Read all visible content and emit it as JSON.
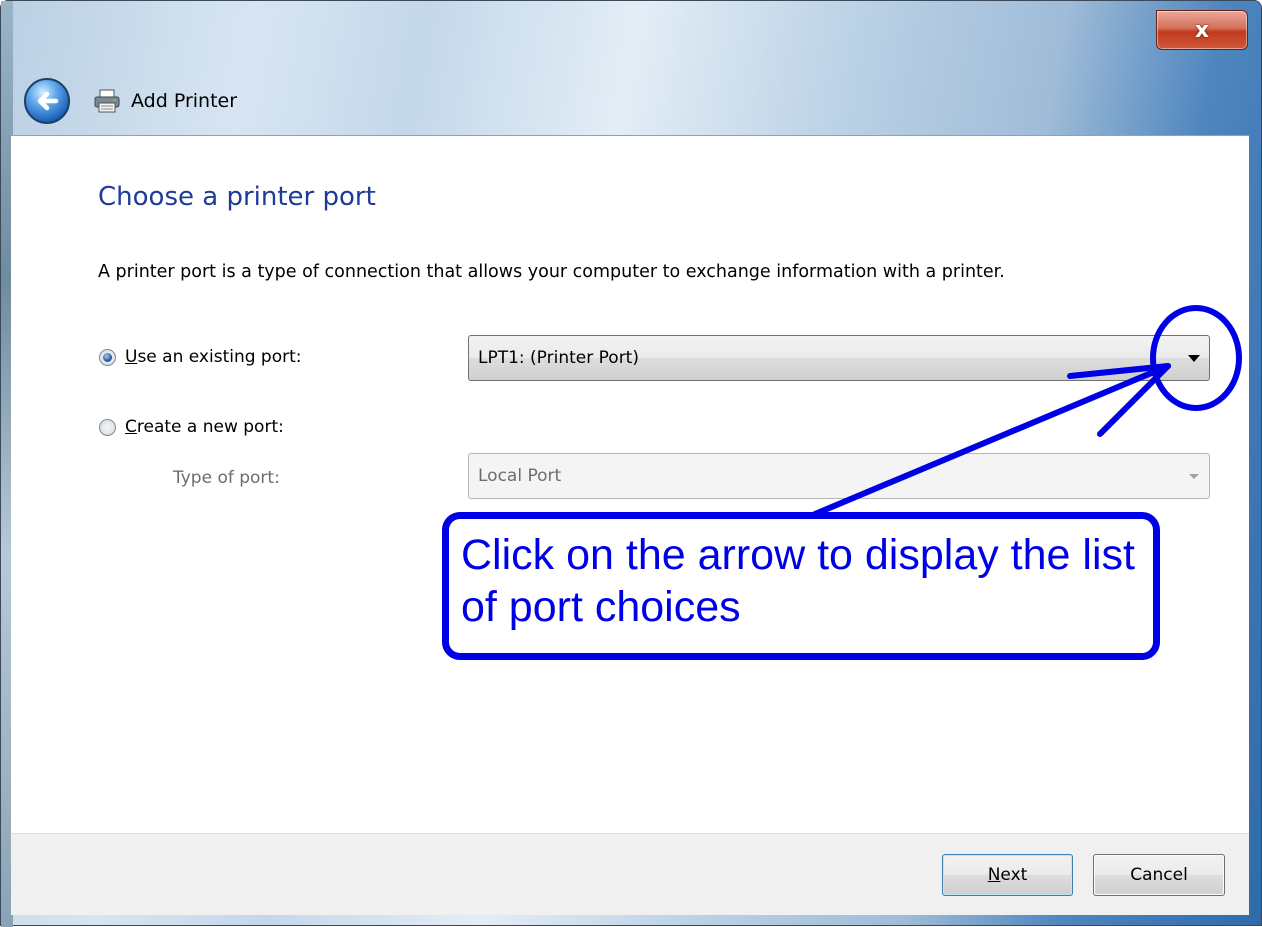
{
  "window": {
    "title": "Add Printer",
    "close_label": "x"
  },
  "page": {
    "heading": "Choose a printer port",
    "description": "A printer port is a type of connection that allows your computer to exchange information with a printer."
  },
  "options": {
    "existing": {
      "label_underlined": "U",
      "label_rest": "se an existing port:",
      "selected": true,
      "value": "LPT1: (Printer Port)"
    },
    "create_new": {
      "label_underlined": "C",
      "label_rest": "reate a new port:",
      "selected": false,
      "type_label": "Type of port:",
      "type_value": "Local Port"
    }
  },
  "footer": {
    "next_underlined": "N",
    "next_rest": "ext",
    "cancel_label": "Cancel"
  },
  "annotation": {
    "text": "Click on the arrow to display the list of port choices",
    "color": "#0000e6"
  },
  "icons": {
    "back": "back-arrow-icon",
    "printer": "printer-icon",
    "dropdown": "chevron-down-icon",
    "close": "close-icon"
  }
}
